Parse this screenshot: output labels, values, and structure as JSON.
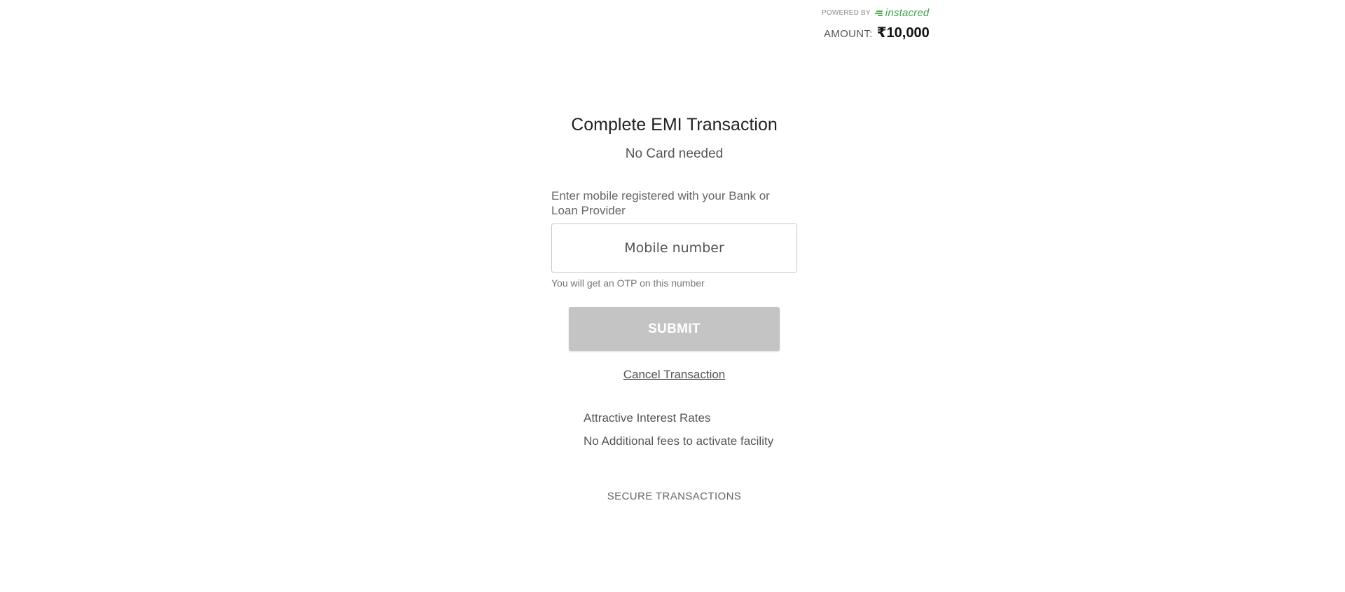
{
  "header": {
    "powered_by": "POWERED BY",
    "brand_name": "instacred",
    "amount_label": "AMOUNT:",
    "amount_value": "₹10,000"
  },
  "main": {
    "title": "Complete EMI Transaction",
    "subtitle": "No Card needed",
    "field_label": "Enter mobile registered with your Bank or Loan Provider",
    "mobile_input": {
      "value": "",
      "placeholder": "Mobile number"
    },
    "otp_hint": "You will get an OTP on this number",
    "submit_label": "SUBMIT",
    "cancel_label": "Cancel Transaction"
  },
  "features": {
    "items": [
      "Attractive Interest Rates",
      "No Additional fees to activate facility"
    ]
  },
  "footer": {
    "secure_text": "SECURE TRANSACTIONS"
  },
  "colors": {
    "brand_green": "#3fa34d",
    "submit_disabled_bg": "#c4c4c4",
    "text_primary": "#222222",
    "text_secondary": "#555555"
  }
}
